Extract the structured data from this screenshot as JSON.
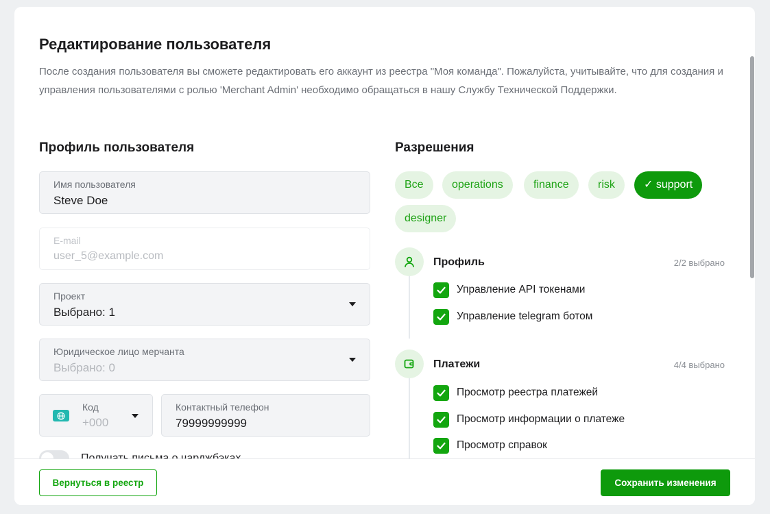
{
  "header": {
    "title": "Редактирование пользователя",
    "description": "После создания пользователя вы сможете редактировать его аккаунт из реестра \"Моя команда\". Пожалуйста, учитывайте, что для создания и управления пользователями с ролью 'Merchant Admin' необходимо обращаться в нашу Службу Технической Поддержки."
  },
  "profile": {
    "section_title": "Профиль пользователя",
    "username": {
      "label": "Имя пользователя",
      "value": "Steve Doe"
    },
    "email": {
      "label": "E-mail",
      "value": "user_5@example.com"
    },
    "project": {
      "label": "Проект",
      "value": "Выбрано: 1"
    },
    "legal_entity": {
      "label": "Юридическое лицо мерчанта",
      "value": "Выбрано: 0"
    },
    "phone_code": {
      "label": "Код",
      "value": "+000",
      "icon": "globe-icon"
    },
    "phone": {
      "label": "Контактный телефон",
      "value": "79999999999"
    },
    "chargeback_toggle": {
      "label": "Получать письма о чарджбэках",
      "on": false
    }
  },
  "permissions": {
    "section_title": "Разрешения",
    "chips": [
      {
        "label": "Все",
        "active": false
      },
      {
        "label": "operations",
        "active": false
      },
      {
        "label": "finance",
        "active": false
      },
      {
        "label": "risk",
        "active": false
      },
      {
        "label": "✓ support",
        "active": true
      },
      {
        "label": "designer",
        "active": false
      }
    ],
    "groups": [
      {
        "title": "Профиль",
        "count": "2/2 выбрано",
        "icon": "user-icon",
        "items": [
          "Управление API токенами",
          "Управление telegram ботом"
        ]
      },
      {
        "title": "Платежи",
        "count": "4/4 выбрано",
        "icon": "wallet-icon",
        "items": [
          "Просмотр реестра платежей",
          "Просмотр информации о платеже",
          "Просмотр справок"
        ]
      }
    ]
  },
  "footer": {
    "back_label": "Вернуться в реестр",
    "save_label": "Сохранить изменения"
  },
  "colors": {
    "accent": "#0e9a0c",
    "chip_bg": "#e5f4e3",
    "chip_text": "#1fa316"
  }
}
